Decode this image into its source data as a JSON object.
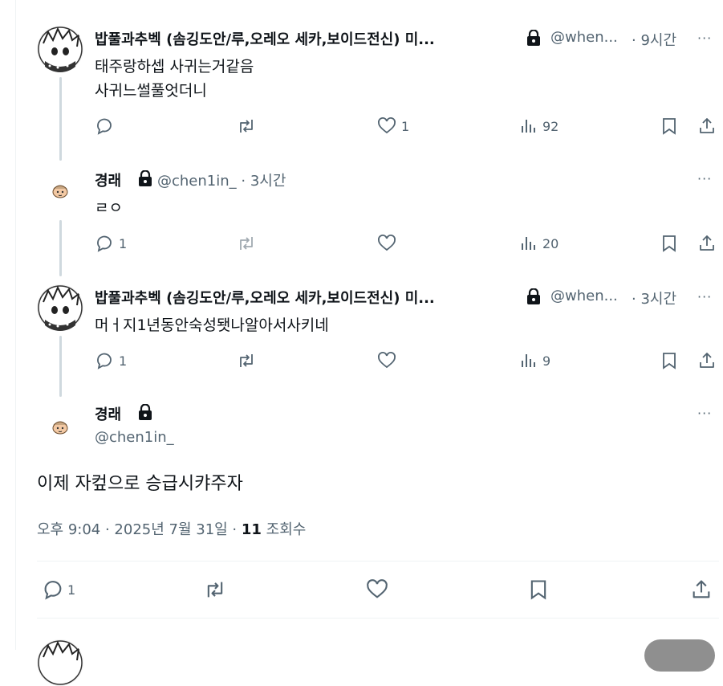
{
  "tweets": [
    {
      "name": "밥풀과추벡 (솜깅도안/루,오레오 세카,보이드전신) 미...",
      "handle": "@when...",
      "time": "· 9시간",
      "lines": [
        "태주랑하셉 사귀는거같음",
        "사귀느썰풀엇더니"
      ],
      "reply_count": "",
      "like_count": "1",
      "view_count": "92"
    },
    {
      "name": "경래",
      "handle": "@chen1in_ · 3시간",
      "lines": [
        "ㄹㅇ"
      ],
      "reply_count": "1",
      "like_count": "",
      "view_count": "20"
    },
    {
      "name": "밥풀과추벡 (솜깅도안/루,오레오 세카,보이드전신) 미...",
      "handle": "@when...",
      "time": "· 3시간",
      "lines": [
        "머ㅓ지1년동안숙성됏나알아서사키네"
      ],
      "reply_count": "1",
      "like_count": "",
      "view_count": "9"
    }
  ],
  "main": {
    "name": "경래",
    "handle": "@chen1in_",
    "text": "이제 자컾으로 승급시캬주자",
    "time": "오후 9:04 · 2025년 7월 31일 · ",
    "views_number": "11",
    "views_label": " 조회수",
    "reply_count": "1"
  },
  "more_label": "···"
}
